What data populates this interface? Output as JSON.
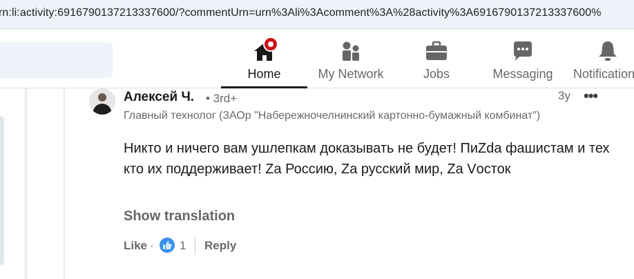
{
  "browser": {
    "url": "rn:li:activity:6916790137213337600/?commentUrn=urn%3Ali%3Acomment%3A%28activity%3A6916790137213337600%"
  },
  "nav": {
    "items": [
      {
        "label": "Home",
        "icon": "home-icon",
        "active": true
      },
      {
        "label": "My Network",
        "icon": "network-icon",
        "active": false
      },
      {
        "label": "Jobs",
        "icon": "briefcase-icon",
        "active": false
      },
      {
        "label": "Messaging",
        "icon": "chat-icon",
        "active": false
      },
      {
        "label": "Notifications",
        "icon": "bell-icon",
        "active": false
      }
    ],
    "home_badge_color": "#cc1016"
  },
  "comment": {
    "author": "Алексей Ч.",
    "degree": "• 3rd+",
    "headline": "Главный технолог (ЗАОр \"Набережночелнинский картонно-бумажный комбинат\")",
    "timestamp": "3y",
    "text": "Никто и ничего вам ушлепкам доказывать не будет! ПиZda фашистам и тех кто их поддерживает! Zа Россию, Zа русский мир, Zа Vосток",
    "show_translation": "Show translation",
    "actions": {
      "like": "Like",
      "separator": "·",
      "like_count": "1",
      "reply": "Reply"
    }
  },
  "colors": {
    "accent_like": "#378fe9",
    "text_primary": "rgba(0,0,0,0.9)",
    "text_secondary": "rgba(0,0,0,0.6)"
  }
}
